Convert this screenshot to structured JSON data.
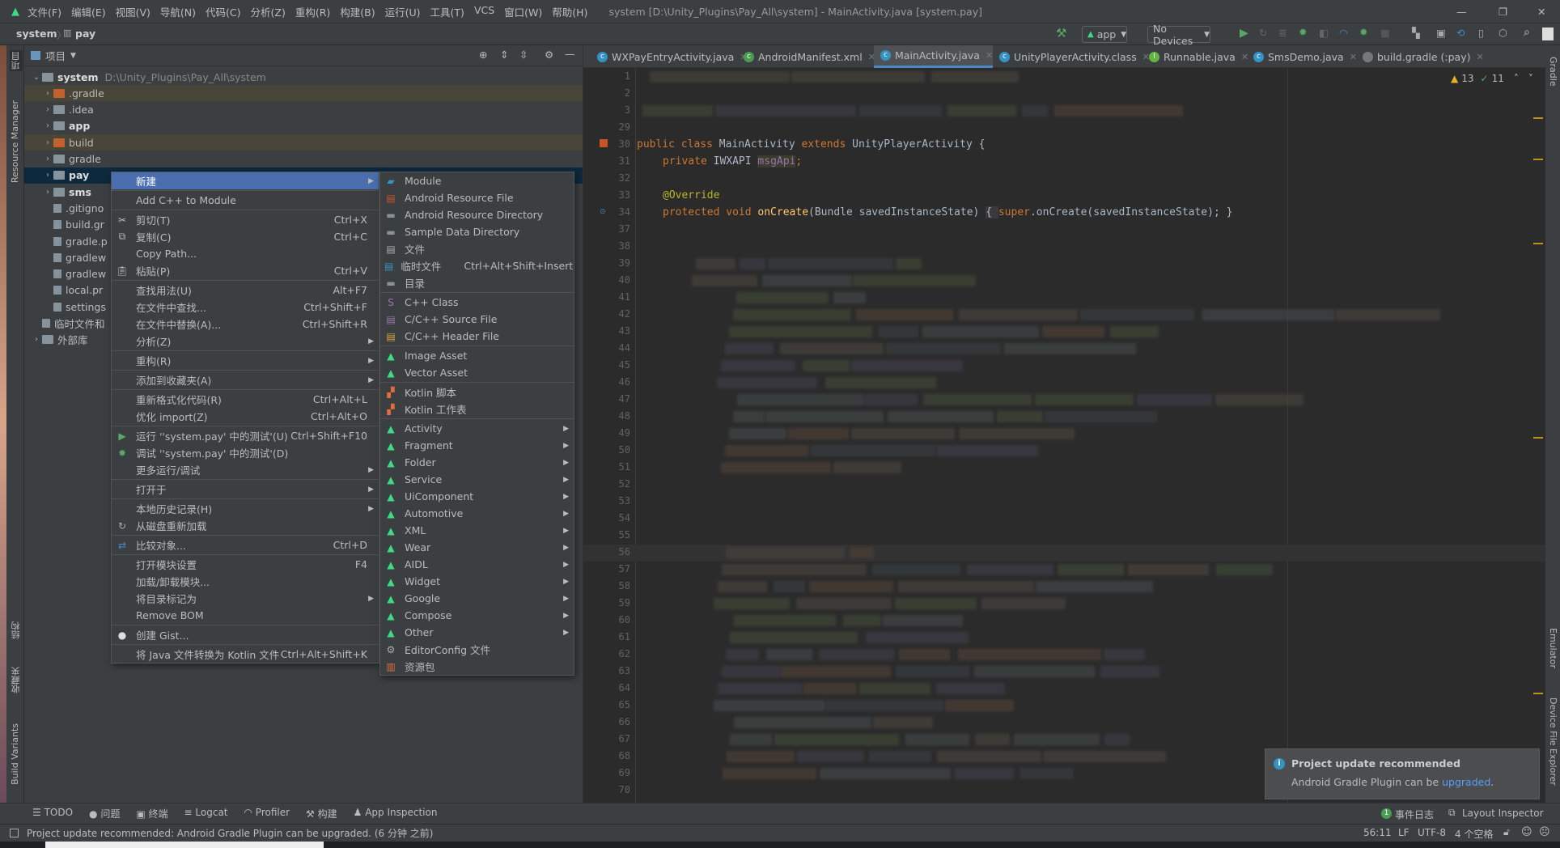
{
  "title_bar": {
    "menu": [
      "文件(F)",
      "编辑(E)",
      "视图(V)",
      "导航(N)",
      "代码(C)",
      "分析(Z)",
      "重构(R)",
      "构建(B)",
      "运行(U)",
      "工具(T)",
      "VCS",
      "窗口(W)",
      "帮助(H)"
    ],
    "window_title": "system [D:\\Unity_Plugins\\Pay_All\\system] - MainActivity.java [system.pay]",
    "controls": {
      "minimize": "—",
      "restore": "❐",
      "close": "✕"
    }
  },
  "nav_bar": {
    "breadcrumb": [
      "system",
      "pay"
    ],
    "run_config": "app",
    "device": "No Devices"
  },
  "left_strip": [
    "项目",
    "Resource Manager",
    "结构",
    "收藏夹",
    "Build Variants"
  ],
  "right_strip": [
    "Gradle",
    "Emulator",
    "Device File Explorer"
  ],
  "project_panel": {
    "title": "项目",
    "tree": [
      {
        "label": "system",
        "extra": "D:\\Unity_Plugins\\Pay_All\\system",
        "depth": 0,
        "expanded": true,
        "icon": "module-folder",
        "bold": true
      },
      {
        "label": ".gradle",
        "depth": 1,
        "icon": "excluded-folder",
        "excluded": true
      },
      {
        "label": ".idea",
        "depth": 1,
        "icon": "folder"
      },
      {
        "label": "app",
        "depth": 1,
        "icon": "app-module",
        "bold": true
      },
      {
        "label": "build",
        "depth": 1,
        "icon": "excluded-folder",
        "excluded": true
      },
      {
        "label": "gradle",
        "depth": 1,
        "icon": "folder"
      },
      {
        "label": "pay",
        "depth": 1,
        "icon": "library-module",
        "bold": true,
        "selected": true
      },
      {
        "label": "sms",
        "depth": 1,
        "icon": "library-module",
        "bold": true
      },
      {
        "label": ".gitigno",
        "depth": 1,
        "icon": "ignore-file",
        "leaf": true
      },
      {
        "label": "build.gr",
        "depth": 1,
        "icon": "gradle-file",
        "leaf": true
      },
      {
        "label": "gradle.p",
        "depth": 1,
        "icon": "properties-file",
        "leaf": true
      },
      {
        "label": "gradlew",
        "depth": 1,
        "icon": "shell-file",
        "leaf": true
      },
      {
        "label": "gradlew",
        "depth": 1,
        "icon": "text-file",
        "leaf": true
      },
      {
        "label": "local.pr",
        "depth": 1,
        "icon": "properties-file",
        "leaf": true
      },
      {
        "label": "settings",
        "depth": 1,
        "icon": "gradle-file",
        "leaf": true
      },
      {
        "label": "临时文件和",
        "depth": 0,
        "icon": "scratches",
        "leaf": true
      },
      {
        "label": "外部库",
        "depth": 0,
        "icon": "libraries"
      }
    ]
  },
  "tabs": [
    {
      "label": "WXPayEntryActivity.java",
      "icon": "class"
    },
    {
      "label": "AndroidManifest.xml",
      "icon": "manifest"
    },
    {
      "label": "MainActivity.java",
      "icon": "class",
      "active": true
    },
    {
      "label": "UnityPlayerActivity.class",
      "icon": "class-locked"
    },
    {
      "label": "Runnable.java",
      "icon": "interface"
    },
    {
      "label": "SmsDemo.java",
      "icon": "class-run"
    },
    {
      "label": "build.gradle (:pay)",
      "icon": "gradle"
    }
  ],
  "editor": {
    "inspections": {
      "warnings": "13",
      "weak_warnings": "11"
    },
    "line_numbers": [
      "1",
      "2",
      "3",
      "29",
      "30",
      "31",
      "32",
      "33",
      "34",
      "37",
      "38",
      "39",
      "40",
      "41",
      "42",
      "43",
      "44",
      "45",
      "46",
      "47",
      "48",
      "49",
      "50",
      "51",
      "52",
      "53",
      "54",
      "55",
      "56",
      "57",
      "58",
      "59",
      "60",
      "61",
      "62",
      "63",
      "64",
      "65",
      "66",
      "67",
      "68",
      "69",
      "70"
    ],
    "current_line": "56",
    "code": {
      "line30": [
        "public class ",
        "MainActivity",
        " extends ",
        "UnityPlayerActivity {"
      ],
      "line31": [
        "private ",
        "IWXAPI ",
        "msgApi",
        ";"
      ],
      "line33": "@Override",
      "line34": [
        "protected void ",
        "onCreate",
        "(Bundle savedInstanceState) ",
        "{ ",
        "super",
        ".onCreate(savedInstanceState); }"
      ]
    }
  },
  "context_menu": [
    {
      "label": "新建",
      "submenu": true,
      "selected": true
    },
    {
      "sep": true
    },
    {
      "label": "Add C++ to Module"
    },
    {
      "sep": true
    },
    {
      "label": "剪切(T)",
      "shortcut": "Ctrl+X",
      "icon": "scissors"
    },
    {
      "label": "复制(C)",
      "shortcut": "Ctrl+C",
      "icon": "copy"
    },
    {
      "label": "Copy Path..."
    },
    {
      "label": "粘贴(P)",
      "shortcut": "Ctrl+V",
      "icon": "paste"
    },
    {
      "sep": true
    },
    {
      "label": "查找用法(U)",
      "shortcut": "Alt+F7"
    },
    {
      "label": "在文件中查找...",
      "shortcut": "Ctrl+Shift+F"
    },
    {
      "label": "在文件中替换(A)...",
      "shortcut": "Ctrl+Shift+R"
    },
    {
      "label": "分析(Z)",
      "submenu": true
    },
    {
      "sep": true
    },
    {
      "label": "重构(R)",
      "submenu": true
    },
    {
      "sep": true
    },
    {
      "label": "添加到收藏夹(A)",
      "submenu": true
    },
    {
      "sep": true
    },
    {
      "label": "重新格式化代码(R)",
      "shortcut": "Ctrl+Alt+L"
    },
    {
      "label": "优化 import(Z)",
      "shortcut": "Ctrl+Alt+O"
    },
    {
      "sep": true
    },
    {
      "label": "运行 ''system.pay' 中的测试'(U)",
      "shortcut": "Ctrl+Shift+F10",
      "icon": "run"
    },
    {
      "label": "调试 ''system.pay' 中的测试'(D)",
      "icon": "debug"
    },
    {
      "label": "更多运行/调试",
      "submenu": true
    },
    {
      "sep": true
    },
    {
      "label": "打开于",
      "submenu": true
    },
    {
      "sep": true
    },
    {
      "label": "本地历史记录(H)",
      "submenu": true
    },
    {
      "label": "从磁盘重新加载",
      "icon": "reload"
    },
    {
      "sep": true
    },
    {
      "label": "比较对象...",
      "shortcut": "Ctrl+D",
      "icon": "compare"
    },
    {
      "sep": true
    },
    {
      "label": "打开模块设置",
      "shortcut": "F4"
    },
    {
      "label": "加载/卸载模块..."
    },
    {
      "label": "将目录标记为",
      "submenu": true
    },
    {
      "label": "Remove BOM"
    },
    {
      "sep": true
    },
    {
      "label": "创建 Gist...",
      "icon": "github"
    },
    {
      "sep": true
    },
    {
      "label": "将 Java 文件转换为 Kotlin 文件",
      "shortcut": "Ctrl+Alt+Shift+K"
    }
  ],
  "new_submenu": [
    {
      "label": "Module",
      "icon": "module"
    },
    {
      "label": "Android Resource File",
      "icon": "resource-file"
    },
    {
      "label": "Android Resource Directory",
      "icon": "folder"
    },
    {
      "label": "Sample Data Directory",
      "icon": "folder"
    },
    {
      "label": "文件",
      "icon": "file"
    },
    {
      "label": "临时文件",
      "shortcut": "Ctrl+Alt+Shift+Insert",
      "icon": "scratch"
    },
    {
      "label": "目录",
      "icon": "folder"
    },
    {
      "sep": true
    },
    {
      "label": "C++ Class",
      "icon": "cpp-class"
    },
    {
      "label": "C/C++ Source File",
      "icon": "cpp-source"
    },
    {
      "label": "C/C++ Header File",
      "icon": "cpp-header"
    },
    {
      "sep": true
    },
    {
      "label": "Image Asset",
      "icon": "android"
    },
    {
      "label": "Vector Asset",
      "icon": "android"
    },
    {
      "sep": true
    },
    {
      "label": "Kotlin 脚本",
      "icon": "kotlin"
    },
    {
      "label": "Kotlin 工作表",
      "icon": "kotlin"
    },
    {
      "sep": true
    },
    {
      "label": "Activity",
      "icon": "android",
      "submenu": true
    },
    {
      "label": "Fragment",
      "icon": "android",
      "submenu": true
    },
    {
      "label": "Folder",
      "icon": "android",
      "submenu": true
    },
    {
      "label": "Service",
      "icon": "android",
      "submenu": true
    },
    {
      "label": "UiComponent",
      "icon": "android",
      "submenu": true
    },
    {
      "label": "Automotive",
      "icon": "android",
      "submenu": true
    },
    {
      "label": "XML",
      "icon": "android",
      "submenu": true
    },
    {
      "label": "Wear",
      "icon": "android",
      "submenu": true
    },
    {
      "label": "AIDL",
      "icon": "android",
      "submenu": true
    },
    {
      "label": "Widget",
      "icon": "android",
      "submenu": true
    },
    {
      "label": "Google",
      "icon": "android",
      "submenu": true
    },
    {
      "label": "Compose",
      "icon": "android",
      "submenu": true
    },
    {
      "label": "Other",
      "icon": "android",
      "submenu": true
    },
    {
      "label": "EditorConfig 文件",
      "icon": "gear"
    },
    {
      "label": "资源包",
      "icon": "resource-bundle"
    }
  ],
  "bottom_tools": [
    {
      "label": "TODO",
      "icon": "list"
    },
    {
      "label": "问题",
      "icon": "problems"
    },
    {
      "label": "终端",
      "icon": "terminal"
    },
    {
      "label": "Logcat",
      "icon": "logcat"
    },
    {
      "label": "Profiler",
      "icon": "gauge"
    },
    {
      "label": "构建",
      "icon": "hammer"
    },
    {
      "label": "App Inspection",
      "icon": "inspect"
    }
  ],
  "bottom_right": {
    "event_log": "事件日志",
    "event_count": "1",
    "layout_inspector": "Layout Inspector"
  },
  "status_bar": {
    "message": "Project update recommended: Android Gradle Plugin can be upgraded. (6 分钟 之前)",
    "position": "56:11",
    "line_sep": "LF",
    "encoding": "UTF-8",
    "indent": "4 个空格"
  },
  "notification": {
    "title": "Project update recommended",
    "body": "Android Gradle Plugin can be ",
    "link": "upgraded",
    "suffix": "."
  },
  "colors": {
    "accent": "#4b6eaf",
    "android_green": "#3ddc84",
    "link": "#589df6",
    "keyword": "#cc7832"
  }
}
